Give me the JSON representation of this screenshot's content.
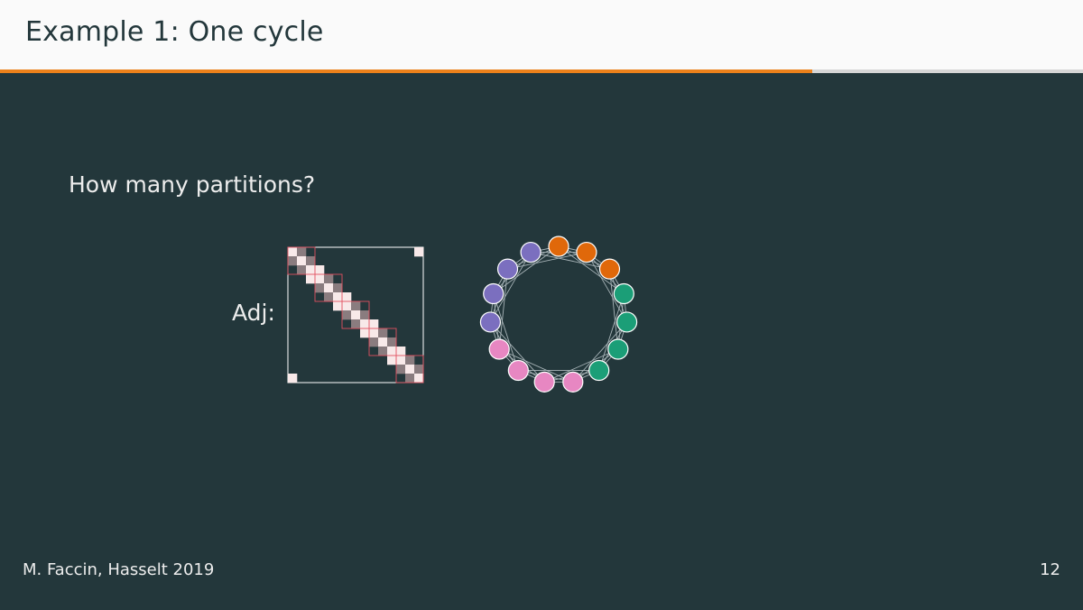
{
  "slide": {
    "title": "Example 1: One cycle",
    "progress": 0.75,
    "question": "How many partitions?",
    "adj_label": "Adj:",
    "footer_author": "M. Faccin, Hasselt 2019",
    "page_number": "12"
  },
  "colors": {
    "background": "#23373b",
    "title_bar": "#fafafa",
    "title_text": "#23373b",
    "text": "#ededed",
    "progress_fill": "#eb811b",
    "progress_track": "#d6d6d6",
    "matrix_band": "#f8e9e9",
    "matrix_block": "#8a7c7f",
    "matrix_grid": "#e05060",
    "edge": "#a8b4b8"
  },
  "diagram": {
    "matrix": {
      "size": 15,
      "blocks": 5,
      "block_size": 3,
      "bandwidth": 1,
      "wraparound": true
    },
    "graph": {
      "node_count": 15,
      "neighbors_per_side": 3,
      "node_groups": [
        "orange",
        "orange",
        "orange",
        "green",
        "green",
        "green",
        "green",
        "pink",
        "pink",
        "pink",
        "pink",
        "purple",
        "purple",
        "purple",
        "purple"
      ],
      "group_colors": {
        "orange": "#e0680a",
        "green": "#1b9e77",
        "pink": "#e787c2",
        "purple": "#7b6fbf"
      }
    }
  }
}
